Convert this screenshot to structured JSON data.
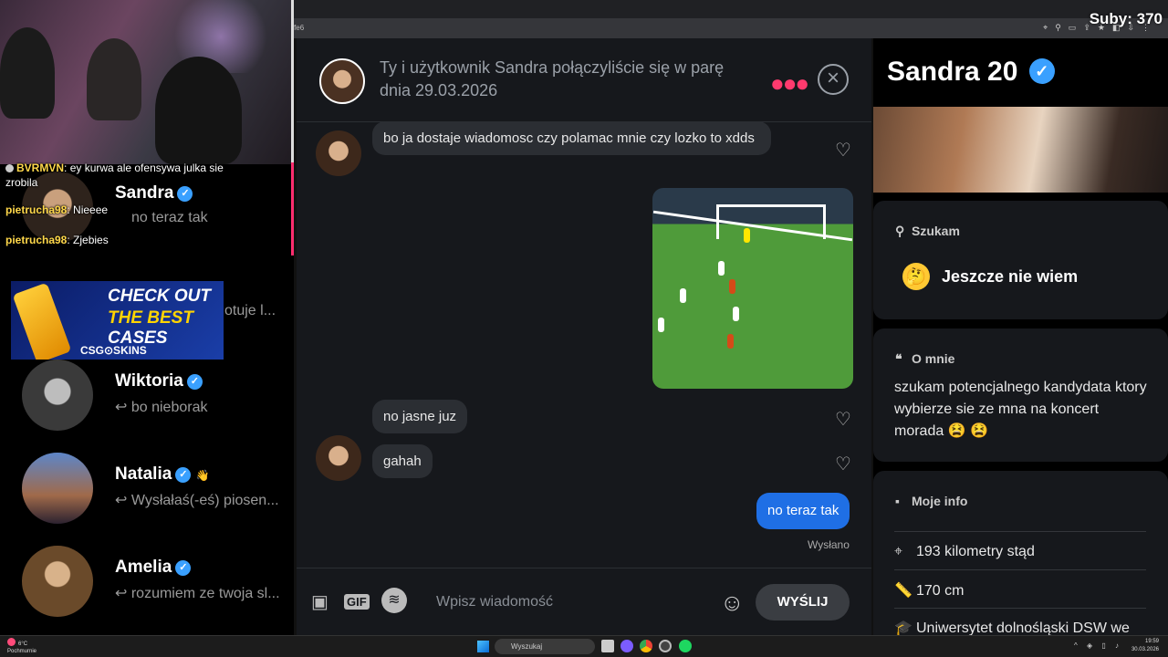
{
  "stream": {
    "subs_label": "Suby: 370",
    "url_fragment": "ffe6",
    "chat": [
      {
        "user": "BVRMVN",
        "text": "ey kurwa ale ofensywa julka sie zrobila"
      },
      {
        "user": "pietrucha98",
        "text": "Nieeee"
      },
      {
        "user": "pietrucha98",
        "text": "Zjebies"
      }
    ],
    "ad": {
      "line1": "CHECK OUT",
      "line2": "THE BEST",
      "line3": "CASES",
      "brand": "CSG⊙SKINS"
    }
  },
  "conversations": [
    {
      "name": "Sandra",
      "preview": "no teraz tak"
    },
    {
      "name": "",
      "preview": "otuje l..."
    },
    {
      "name": "Wiktoria",
      "preview": "↩ bo nieborak"
    },
    {
      "name": "Natalia",
      "preview": "↩ Wysłałaś(-eś) piosen..."
    },
    {
      "name": "Amelia",
      "preview": "↩ rozumiem ze twoja sl..."
    }
  ],
  "chat_header": {
    "match_text": "Ty i użytkownik Sandra połączyliście się w parę dnia 29.03.2026"
  },
  "messages": {
    "m1": "bo ja dostaje wiadomosc czy polamac mnie czy lozko to xdds",
    "m2": "no jasne juz",
    "m3": "gahah",
    "m4": "no teraz tak",
    "status": "Wysłano"
  },
  "composer": {
    "gif_label": "GIF",
    "placeholder": "Wpisz wiadomość",
    "send_label": "WYŚLIJ"
  },
  "profile": {
    "name_age": "Sandra 20",
    "seeking_title": "Szukam",
    "seeking_value": "Jeszcze nie wiem",
    "about_title": "O mnie",
    "about_text": "szukam potencjalnego kandydata ktory wybierze sie ze mna na koncert morada 😫 😫",
    "info_title": "Moje info",
    "distance": "193 kilometry stąd",
    "height": "170 cm",
    "school": "Uniwersytet dolnośląski DSW we"
  },
  "taskbar": {
    "weather_temp": "6°C",
    "weather_desc": "Pochmurnie",
    "search_label": "Wyszukaj",
    "time": "19:59",
    "date": "30.03.2026"
  },
  "colors": {
    "accent_pink": "#ff3a6e",
    "outgoing_bubble": "#1f6fe5",
    "verified": "#3aa0ff"
  }
}
